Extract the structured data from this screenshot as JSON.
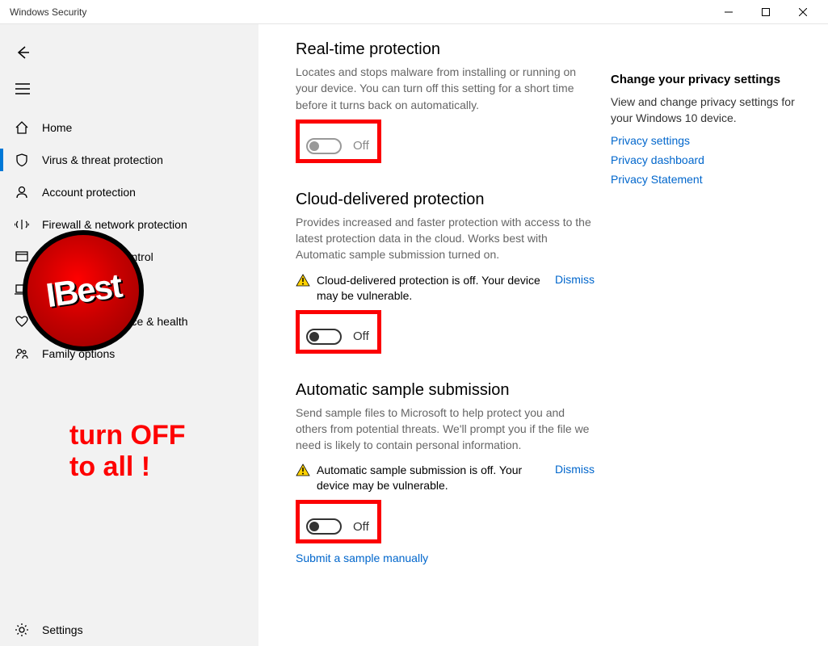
{
  "window": {
    "title": "Windows Security"
  },
  "sidebar": {
    "items": [
      {
        "label": "Home"
      },
      {
        "label": "Virus & threat protection"
      },
      {
        "label": "Account protection"
      },
      {
        "label": "Firewall & network protection"
      },
      {
        "label": "App & browser control"
      },
      {
        "label": "Device security"
      },
      {
        "label": "Device performance & health"
      },
      {
        "label": "Family options"
      }
    ],
    "settings_label": "Settings"
  },
  "sections": {
    "realtime": {
      "title": "Real-time protection",
      "desc": "Locates and stops malware from installing or running on your device. You can turn off this setting for a short time before it turns back on automatically.",
      "toggle_label": "Off"
    },
    "cloud": {
      "title": "Cloud-delivered protection",
      "desc": "Provides increased and faster protection with access to the latest protection data in the cloud. Works best with Automatic sample submission turned on.",
      "warn": "Cloud-delivered protection is off. Your device may be vulnerable.",
      "dismiss": "Dismiss",
      "toggle_label": "Off"
    },
    "sample": {
      "title": "Automatic sample submission",
      "desc": "Send sample files to Microsoft to help protect you and others from potential threats. We'll prompt you if the file we need is likely to contain personal information.",
      "warn": "Automatic sample submission is off. Your device may be vulnerable.",
      "dismiss": "Dismiss",
      "toggle_label": "Off",
      "submit_link": "Submit a sample manually"
    }
  },
  "aside": {
    "title": "Change your privacy settings",
    "desc": "View and change privacy settings for your Windows 10 device.",
    "links": [
      "Privacy settings",
      "Privacy dashboard",
      "Privacy Statement"
    ]
  },
  "annotation": {
    "line1": "turn OFF",
    "line2": "to all !",
    "logo_text": "IBest"
  }
}
